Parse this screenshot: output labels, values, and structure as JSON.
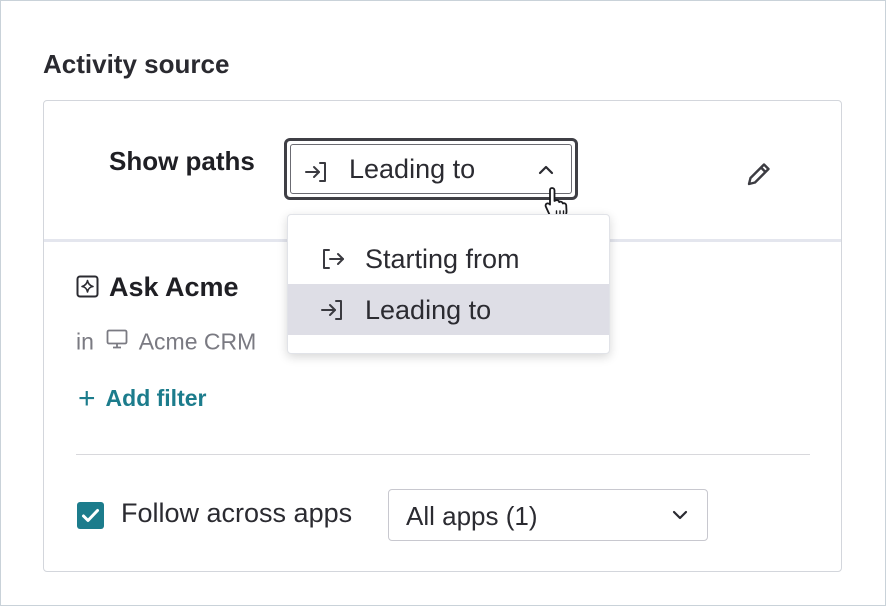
{
  "section": {
    "title": "Activity source"
  },
  "show_paths": {
    "label": "Show paths",
    "selected": "Leading to",
    "options": [
      {
        "label": "Starting from",
        "icon": "arrow-out-of-bracket-icon"
      },
      {
        "label": "Leading to",
        "icon": "arrow-into-bracket-icon"
      }
    ]
  },
  "event": {
    "name": "Ask Acme",
    "in_prefix": "in",
    "app": "Acme CRM",
    "add_filter_label": "Add filter"
  },
  "follow": {
    "checked": true,
    "label": "Follow across apps",
    "apps_value": "All apps (1)"
  },
  "colors": {
    "accent": "#1c7c8c",
    "selected_row": "#dedee6",
    "border": "#d3d6dc"
  }
}
